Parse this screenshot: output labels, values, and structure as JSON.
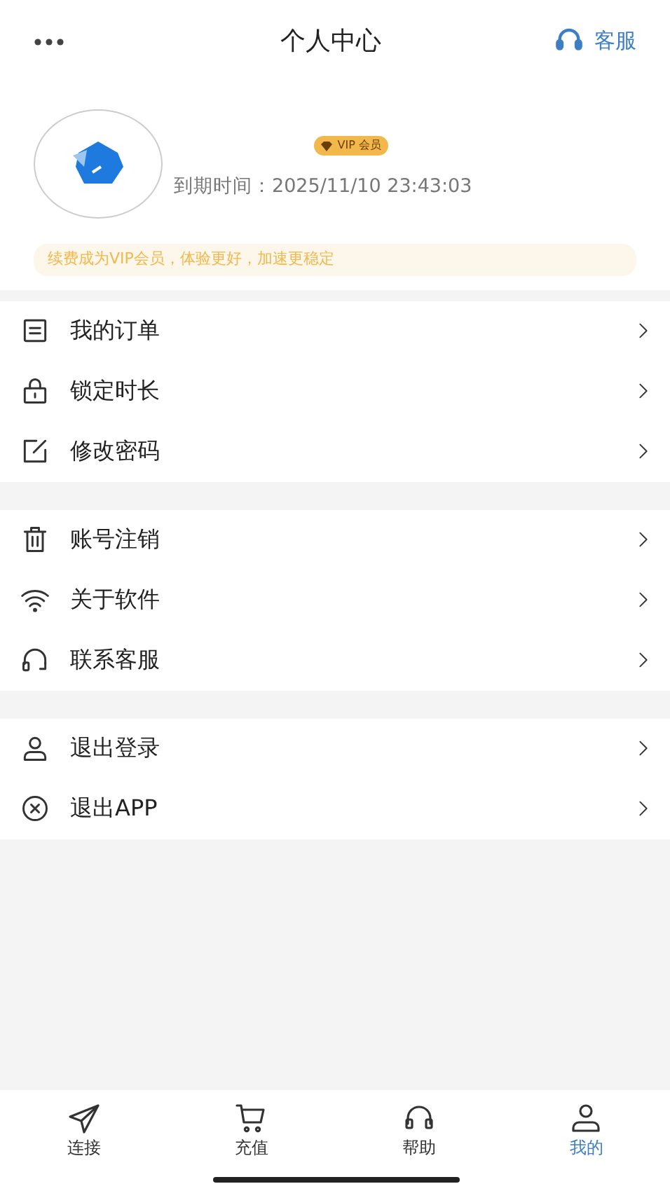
{
  "header": {
    "title": "个人中心",
    "service_label": "客服"
  },
  "profile": {
    "badge": "VIP 会员",
    "expiry_label": "到期时间：",
    "expiry_time": "2025/11/10 23:43:03",
    "promo": "续费成为VIP会员，体验更好，加速更稳定"
  },
  "menu_groups": [
    {
      "items": [
        {
          "label": "我的订单"
        },
        {
          "label": "锁定时长"
        },
        {
          "label": "修改密码"
        }
      ]
    },
    {
      "items": [
        {
          "label": "账号注销"
        },
        {
          "label": "关于软件"
        },
        {
          "label": "联系客服"
        }
      ]
    },
    {
      "items": [
        {
          "label": "退出登录"
        },
        {
          "label": "退出APP"
        }
      ]
    }
  ],
  "tabs": [
    {
      "label": "连接",
      "selected": false
    },
    {
      "label": "充值",
      "selected": false
    },
    {
      "label": "帮助",
      "selected": false
    },
    {
      "label": "我的",
      "selected": true
    }
  ]
}
